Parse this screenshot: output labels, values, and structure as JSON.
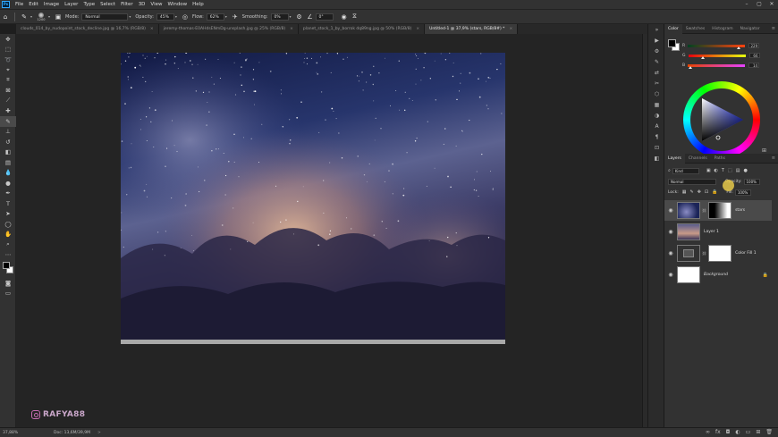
{
  "menu": {
    "items": [
      "File",
      "Edit",
      "Image",
      "Layer",
      "Type",
      "Select",
      "Filter",
      "3D",
      "View",
      "Window",
      "Help"
    ]
  },
  "options": {
    "brush_size": "1200",
    "mode_label": "Mode:",
    "mode_value": "Normal",
    "opacity_label": "Opacity:",
    "opacity_value": "45%",
    "flow_label": "Flow:",
    "flow_value": "62%",
    "smoothing_label": "Smoothing:",
    "smoothing_value": "0%",
    "angle_value": "0°"
  },
  "tabs": [
    {
      "label": "clouds_014_by_nudopoint_stock_decline.jpg @ 16,7% (RGB/8)"
    },
    {
      "label": "jeremy-thomas-E0AHdsENmDg-unsplash.jpg @ 25% (RGB/8)"
    },
    {
      "label": "planet_stock_1_by_borrok dq89ng.jpg @ 50% (RGB/8)"
    },
    {
      "label": "Untitled-1 @ 37,9% (stars, RGB/8#) *"
    }
  ],
  "watermark": {
    "text": "RAFYA88"
  },
  "status": {
    "zoom": "37,88%",
    "doc_info": "Doc: 13,6M/39,9M",
    "arrow": ">"
  },
  "color_panel": {
    "tabs": [
      "Color",
      "Swatches",
      "Histogram",
      "Navigator"
    ],
    "sliders": [
      {
        "label": "R",
        "value": "229",
        "pos": 0.9
      },
      {
        "label": "G",
        "value": "66",
        "pos": 0.26
      },
      {
        "label": "B",
        "value": "14",
        "pos": 0.06
      }
    ]
  },
  "layers_panel": {
    "tabs": [
      "Layers",
      "Channels",
      "Paths"
    ],
    "filter_label": "Kind",
    "blend_mode": "Normal",
    "opacity_label": "Opacity:",
    "opacity_value": "100%",
    "lock_label": "Lock:",
    "fill_label": "Fill:",
    "fill_value": "100%",
    "layers": [
      {
        "name": "stars",
        "selected": true,
        "thumb": "stars"
      },
      {
        "name": "Layer 1",
        "selected": false,
        "thumb": "clouds"
      },
      {
        "name": "Color Fill 1",
        "selected": false,
        "thumb": "fill"
      },
      {
        "name": "Background",
        "selected": false,
        "thumb": "white"
      }
    ]
  },
  "colors": {
    "accent": "#31a8ff",
    "panel": "#323232",
    "canvas_bg": "#242424"
  }
}
